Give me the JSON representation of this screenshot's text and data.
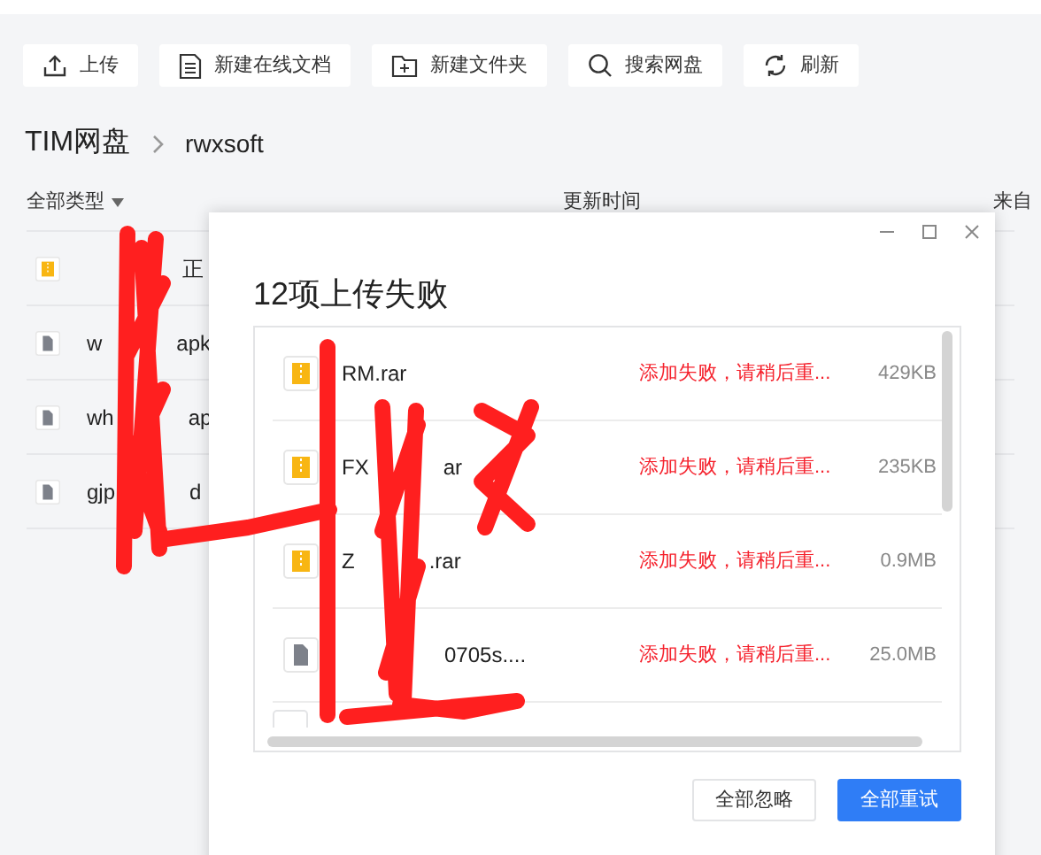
{
  "toolbar": [
    {
      "kind": "upload",
      "label": "上传"
    },
    {
      "kind": "doc",
      "label": "新建在线文档"
    },
    {
      "kind": "folder",
      "label": "新建文件夹"
    },
    {
      "kind": "search",
      "label": "搜索网盘"
    },
    {
      "kind": "refresh",
      "label": "刷新"
    }
  ],
  "breadcrumb": [
    "TIM网盘",
    "rwxsoft"
  ],
  "columns": [
    "全部类型",
    "更新时间",
    "来自"
  ],
  "files": [
    {
      "kind": "archive",
      "name_parts": [
        "正"
      ]
    },
    {
      "kind": "file",
      "name_parts": [
        "w",
        "apk"
      ]
    },
    {
      "kind": "file",
      "name_parts": [
        "wh",
        "ap"
      ]
    },
    {
      "kind": "file",
      "name_parts": [
        "gjp",
        "d"
      ]
    }
  ],
  "dialog": {
    "title": "12项上传失败",
    "items": [
      {
        "kind": "archive",
        "name_parts": [
          "RM.rar"
        ],
        "status": "添加失败，请稍后重...",
        "size": "429KB"
      },
      {
        "kind": "archive",
        "name_parts": [
          "FX",
          "ar"
        ],
        "status": "添加失败，请稍后重...",
        "size": "235KB"
      },
      {
        "kind": "archive",
        "name_parts": [
          "Z",
          ".rar"
        ],
        "status": "添加失败，请稍后重...",
        "size": "0.9MB"
      },
      {
        "kind": "file",
        "name_parts": [
          "0705s...."
        ],
        "status": "添加失败，请稍后重...",
        "size": "25.0MB"
      }
    ],
    "buttons": [
      {
        "label": "全部忽略",
        "primary": false
      },
      {
        "label": "全部重试",
        "primary": true
      }
    ]
  }
}
